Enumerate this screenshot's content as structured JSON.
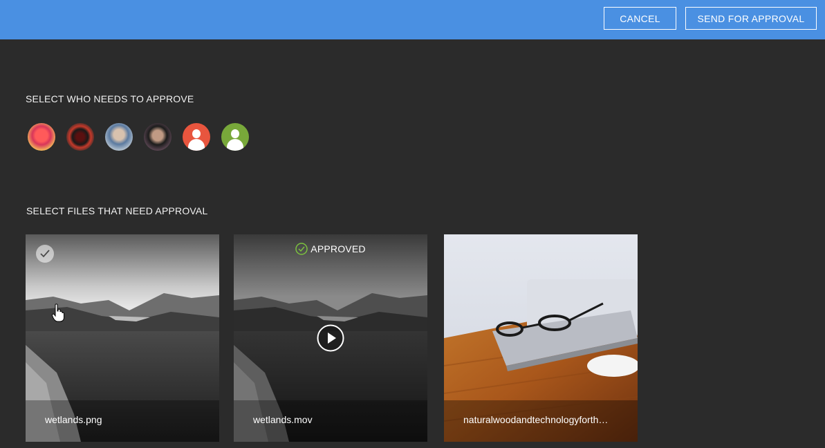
{
  "header": {
    "cancel_label": "CANCEL",
    "send_label": "SEND FOR APPROVAL",
    "bar_color": "#4a90e2"
  },
  "approvers": {
    "title": "SELECT WHO NEEDS TO APPROVE",
    "avatars": [
      {
        "kind": "photo"
      },
      {
        "kind": "photo"
      },
      {
        "kind": "photo"
      },
      {
        "kind": "photo"
      },
      {
        "kind": "placeholder",
        "color": "#e8553e"
      },
      {
        "kind": "placeholder",
        "color": "#78a83a"
      }
    ]
  },
  "files": {
    "title": "SELECT FILES THAT NEED APPROVAL",
    "items": [
      {
        "name": "wetlands.png",
        "selected": true,
        "status": ""
      },
      {
        "name": "wetlands.mov",
        "selected": false,
        "status": "APPROVED",
        "icon": "play-icon"
      },
      {
        "name": "naturalwoodandtechnologyforth…",
        "selected": false,
        "status": ""
      }
    ]
  }
}
